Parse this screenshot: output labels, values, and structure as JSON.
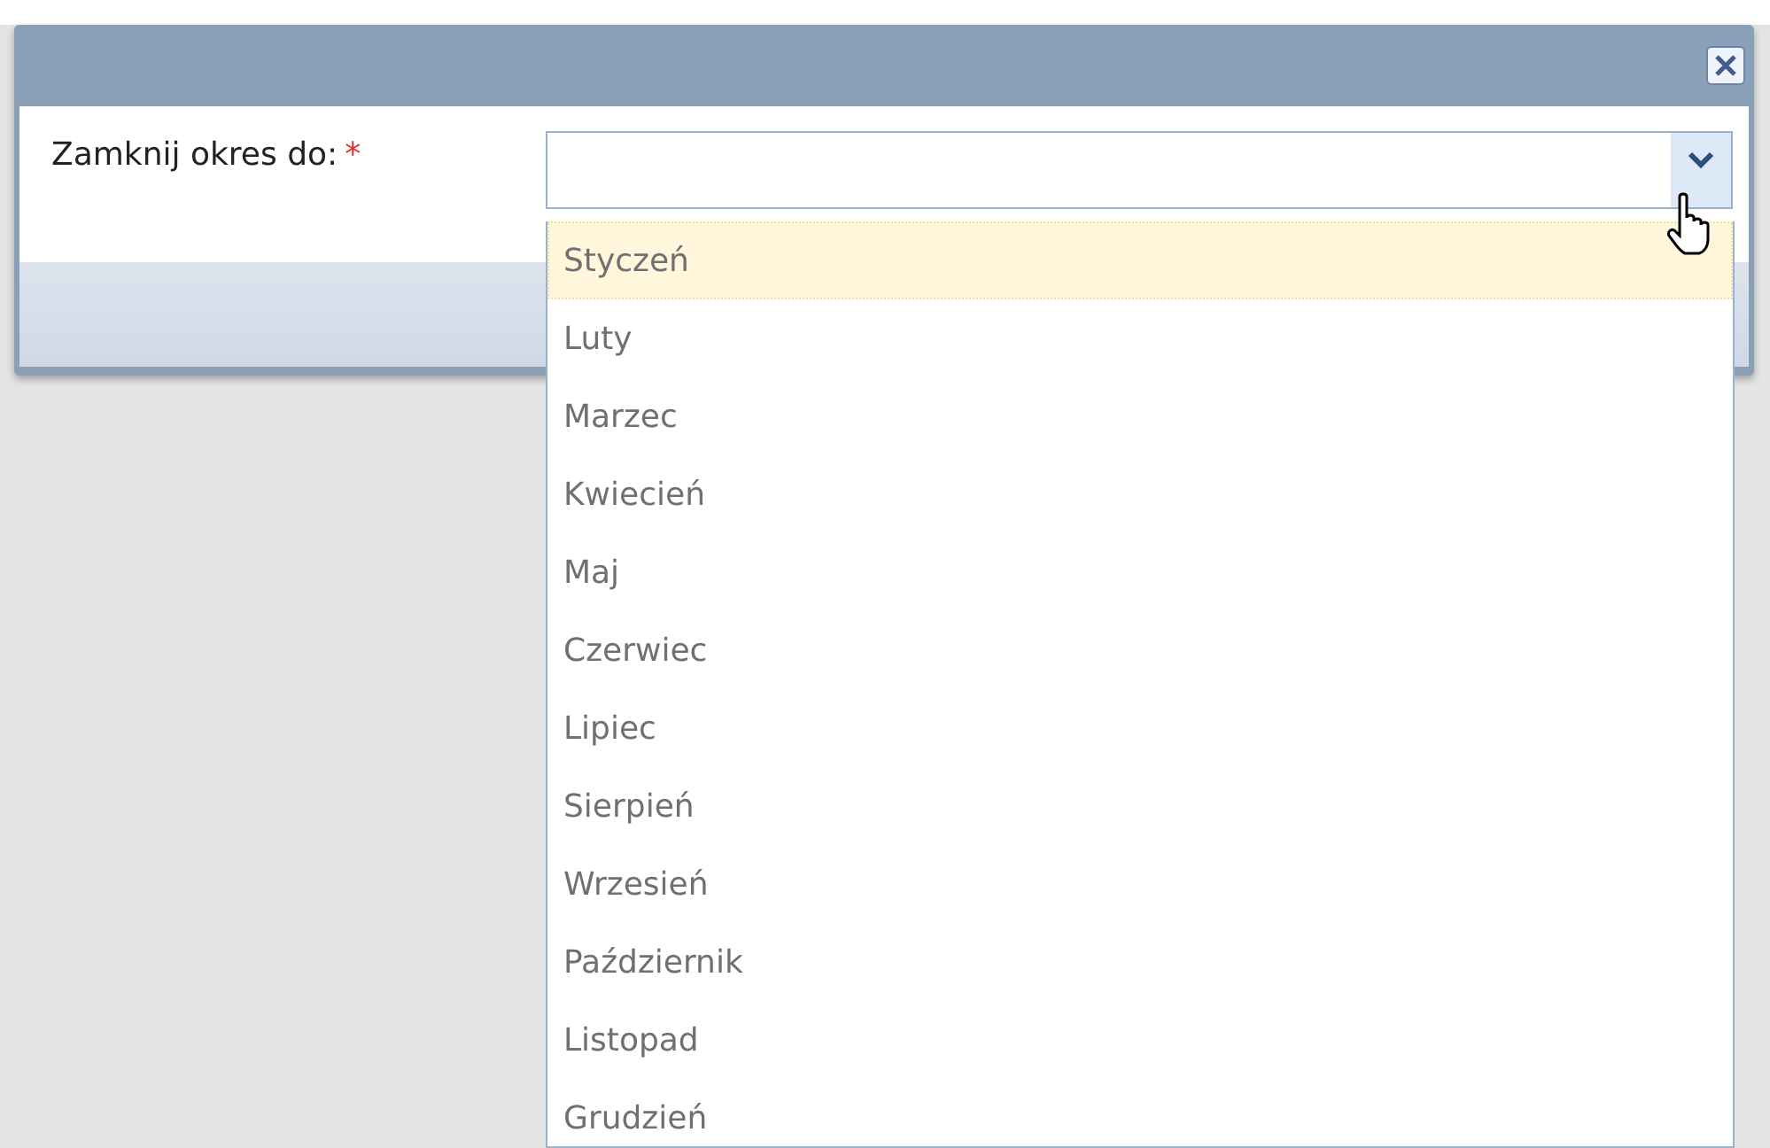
{
  "dialog": {
    "field": {
      "label": "Zamknij okres do:",
      "required_mark": "*"
    },
    "dropdown": {
      "options": [
        {
          "label": "Styczeń",
          "selected": true
        },
        {
          "label": "Luty",
          "selected": false
        },
        {
          "label": "Marzec",
          "selected": false
        },
        {
          "label": "Kwiecień",
          "selected": false
        },
        {
          "label": "Maj",
          "selected": false
        },
        {
          "label": "Czerwiec",
          "selected": false
        },
        {
          "label": "Lipiec",
          "selected": false
        },
        {
          "label": "Sierpień",
          "selected": false
        },
        {
          "label": "Wrzesień",
          "selected": false
        },
        {
          "label": "Październik",
          "selected": false
        },
        {
          "label": "Listopad",
          "selected": false
        },
        {
          "label": "Grudzień",
          "selected": false
        }
      ]
    }
  }
}
